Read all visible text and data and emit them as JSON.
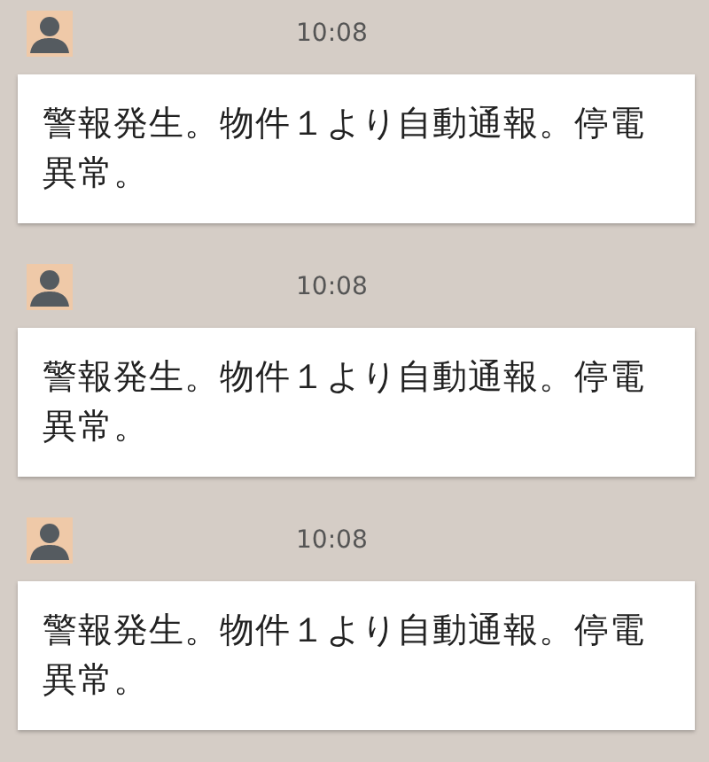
{
  "messages": [
    {
      "time": "10:08",
      "text": "警報発生。物件１より自動通報。停電異常。"
    },
    {
      "time": "10:08",
      "text": "警報発生。物件１より自動通報。停電異常。"
    },
    {
      "time": "10:08",
      "text": "警報発生。物件１より自動通報。停電異常。"
    }
  ]
}
